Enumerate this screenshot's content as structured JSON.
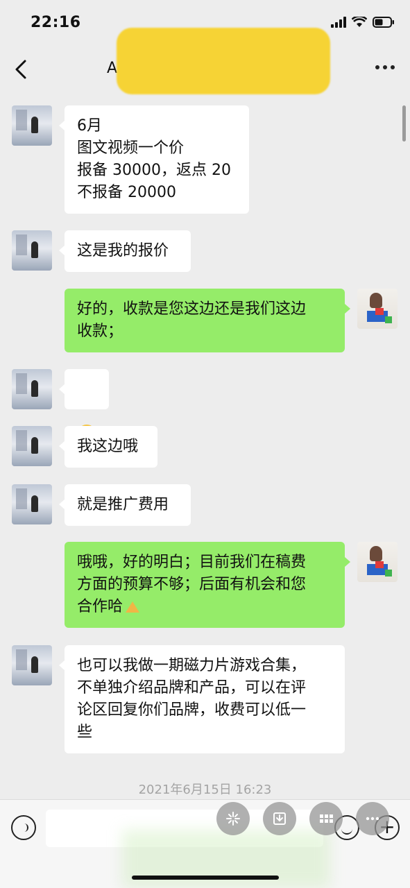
{
  "status_bar": {
    "time": "22:16"
  },
  "header": {
    "back_icon": "chevron-left-icon",
    "title": "A",
    "more_icon": "ellipsis-icon",
    "redaction_color": "#f6d335"
  },
  "messages": [
    {
      "side": "left",
      "text": "6月\n图文视频一个价\n报备 30000，返点 20\n不报备 20000"
    },
    {
      "side": "left",
      "text": "这是我的报价"
    },
    {
      "side": "right",
      "text": "好的，收款是您这边还是我们这边\n收款；"
    },
    {
      "side": "left",
      "emoji": "face-with-tears-of-joy"
    },
    {
      "side": "left",
      "text": "我这边哦"
    },
    {
      "side": "left",
      "text": "就是推广费用"
    },
    {
      "side": "right",
      "text": "哦哦，好的明白；目前我们在稿费\n方面的预算不够；后面有机会和您\n合作哈",
      "trailing_emoji": "folded-hands"
    },
    {
      "side": "left",
      "text": "也可以我做一期磁力片游戏合集，\n不单独介绍品牌和产品，可以在评\n论区回复你们品牌，收费可以低一\n些"
    }
  ],
  "timestamp": "2021年6月15日 16:23",
  "input_bar": {
    "voice_icon": "voice-icon",
    "emoji_icon": "smile-icon",
    "plus_icon": "plus-icon",
    "text_value": ""
  },
  "floating_actions": [
    "sparkle-icon",
    "download-icon",
    "grid-icon",
    "more-icon"
  ],
  "colors": {
    "self_bubble": "#95ec69",
    "other_bubble": "#ffffff",
    "background": "#ededed"
  }
}
